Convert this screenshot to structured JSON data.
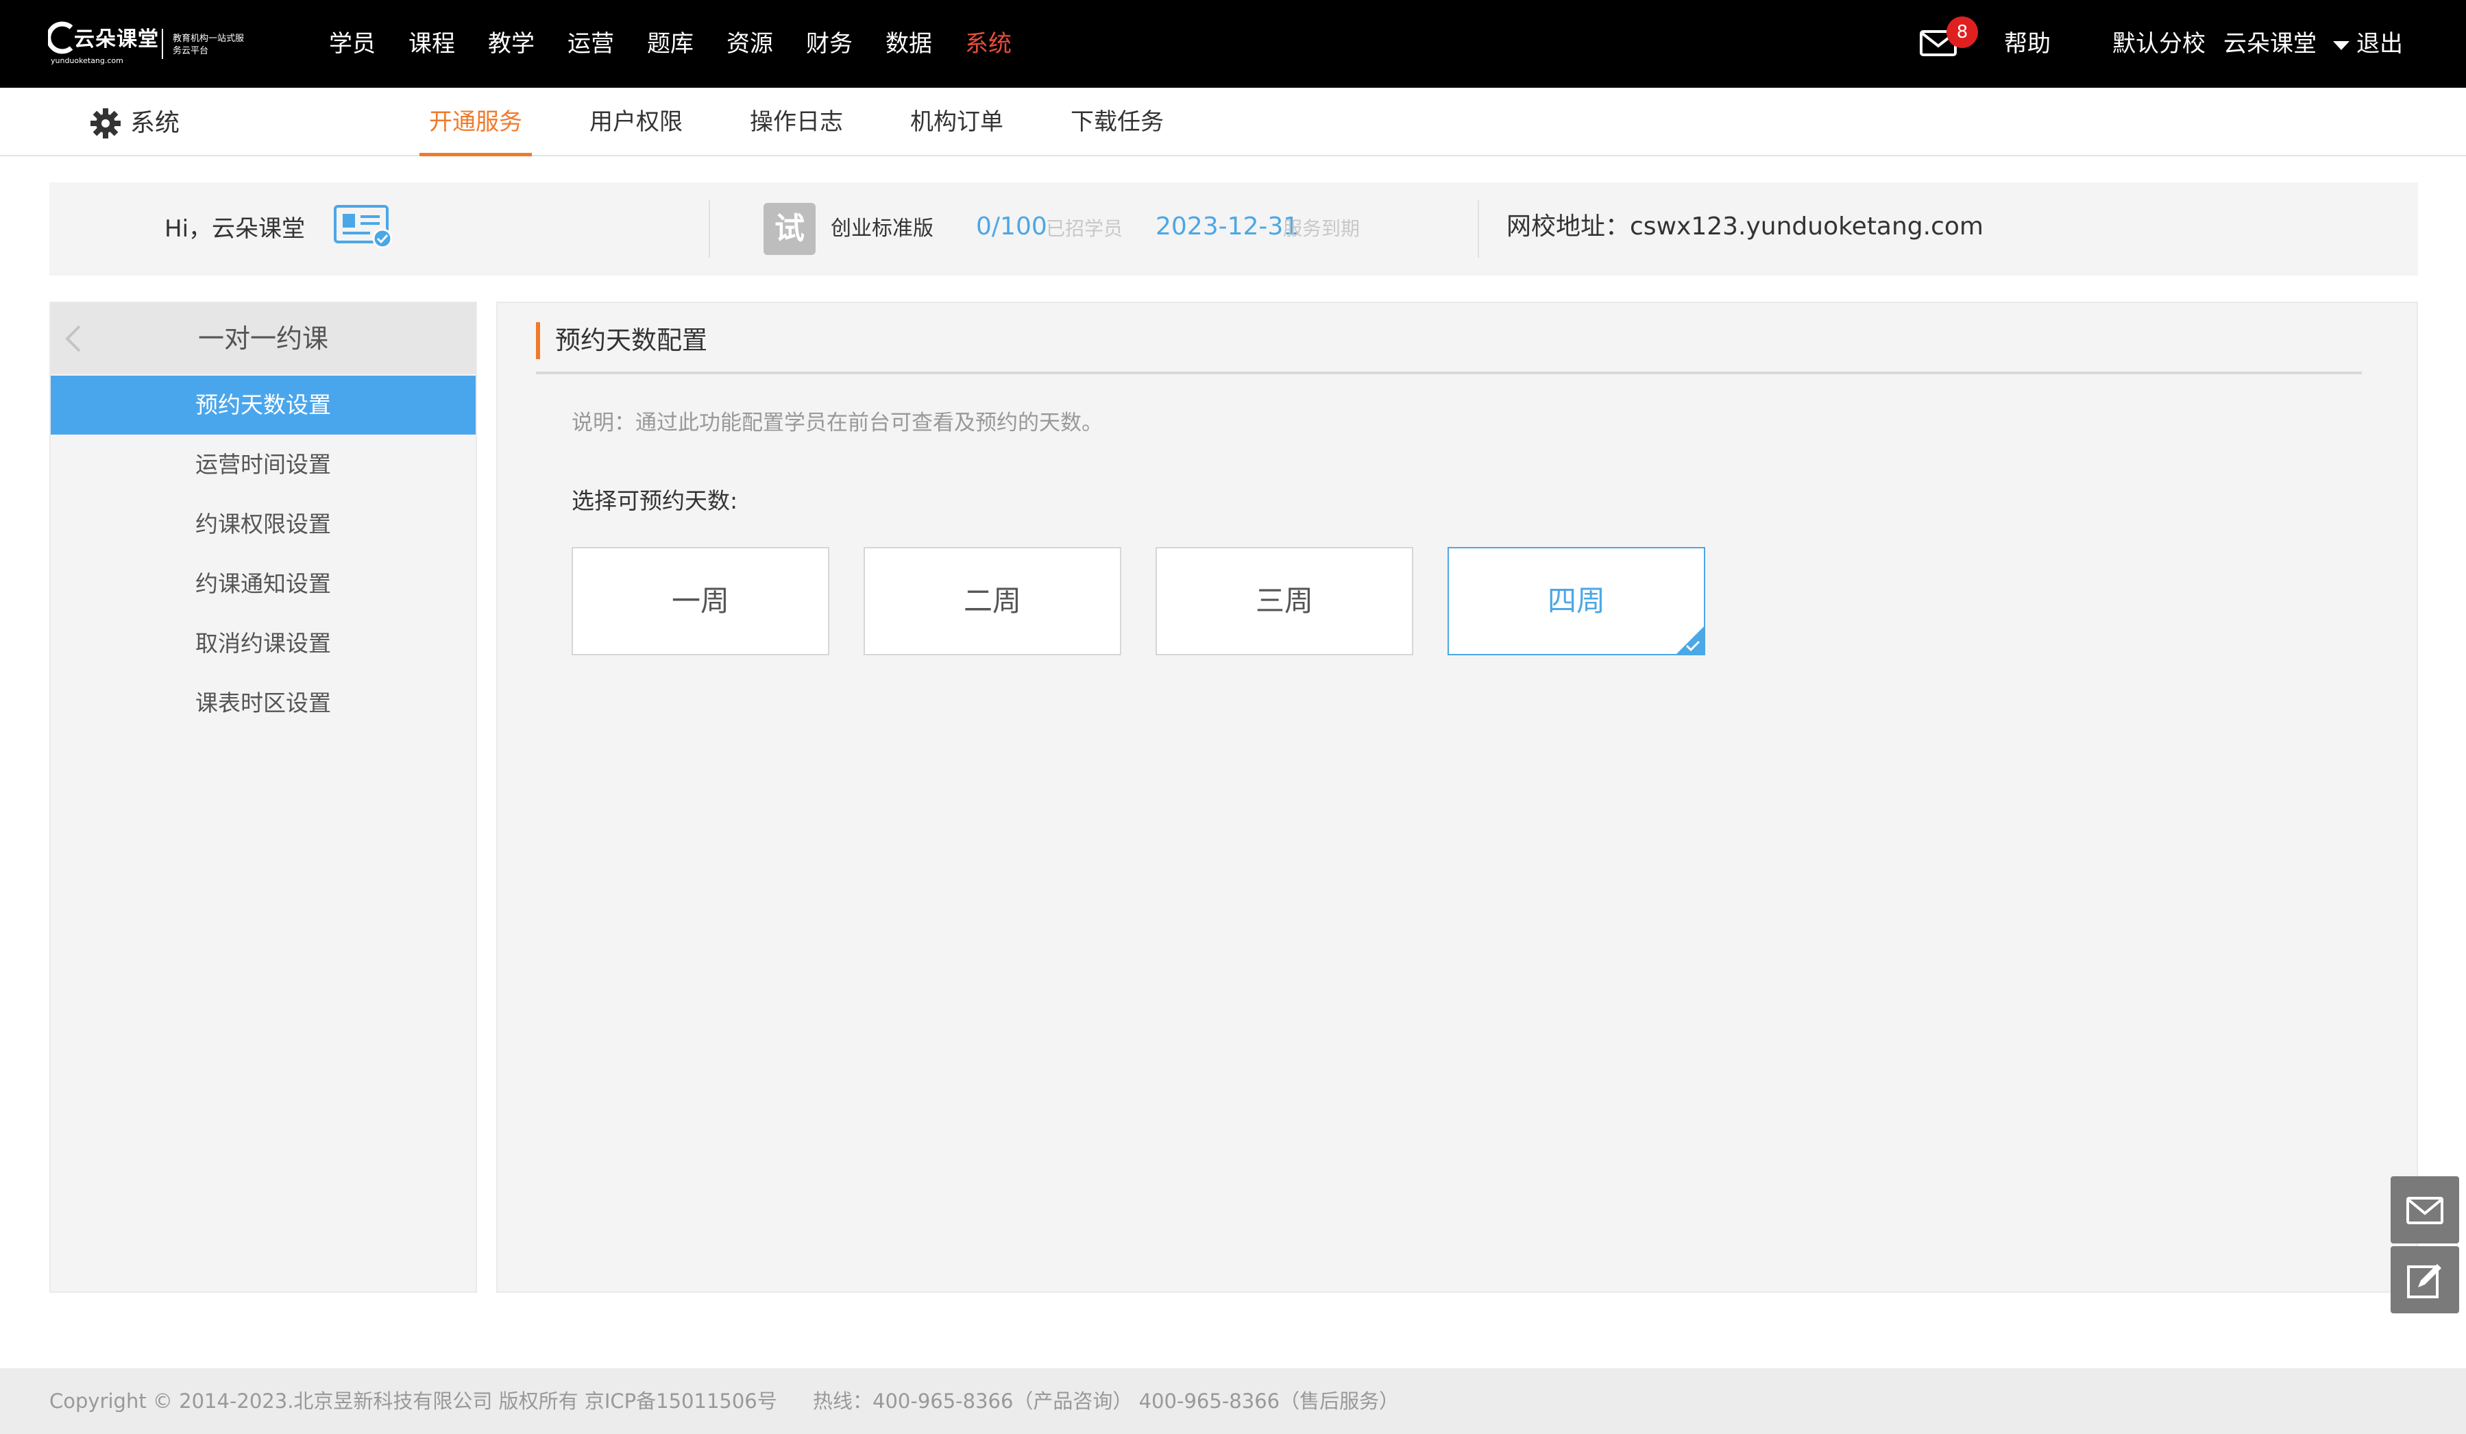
{
  "brand": {
    "name": "云朵课堂",
    "domain": "yunduoketang.com",
    "slogan": "教育机构一站式服务云平台"
  },
  "topnav": {
    "items": [
      "学员",
      "课程",
      "教学",
      "运营",
      "题库",
      "资源",
      "财务",
      "数据",
      "系统"
    ],
    "active": "系统",
    "unread_count": "8",
    "help": "帮助",
    "school": "默认分校",
    "username": "云朵课堂",
    "logout": "退出"
  },
  "subnav": {
    "section": "系统",
    "tabs": [
      "开通服务",
      "用户权限",
      "操作日志",
      "机构订单",
      "下载任务"
    ],
    "active": "开通服务"
  },
  "account": {
    "greeting": "Hi，云朵课堂",
    "trial_badge": "试",
    "edition": "创业标准版",
    "students": "0/100",
    "students_label": "已招学员",
    "expiry": "2023-12-31",
    "expiry_label": "服务到期",
    "site_label": "网校地址：",
    "site_url": "cswx123.yunduoketang.com"
  },
  "sidebar": {
    "title": "一对一约课",
    "items": [
      "预约天数设置",
      "运营时间设置",
      "约课权限设置",
      "约课通知设置",
      "取消约课设置",
      "课表时区设置"
    ],
    "active": "预约天数设置"
  },
  "panel": {
    "title": "预约天数配置",
    "description": "说明：通过此功能配置学员在前台可查看及预约的天数。",
    "choose_label": "选择可预约天数:",
    "options": [
      "一周",
      "二周",
      "三周",
      "四周"
    ],
    "selected": "四周"
  },
  "footer": {
    "copyright": "Copyright © 2014-2023.北京昱新科技有限公司 版权所有 京ICP备15011506号",
    "hotline": "热线：400-965-8366（产品咨询） 400-965-8366（售后服务）"
  },
  "colors": {
    "accent_orange": "#f07a2a",
    "accent_blue": "#4ba7e6",
    "active_nav_red": "#e74c3c",
    "badge_red": "#e02020"
  },
  "icons": [
    "mail-icon",
    "gear-icon",
    "id-card-icon",
    "chevron-left-icon",
    "check-icon",
    "envelope-icon",
    "edit-icon"
  ]
}
